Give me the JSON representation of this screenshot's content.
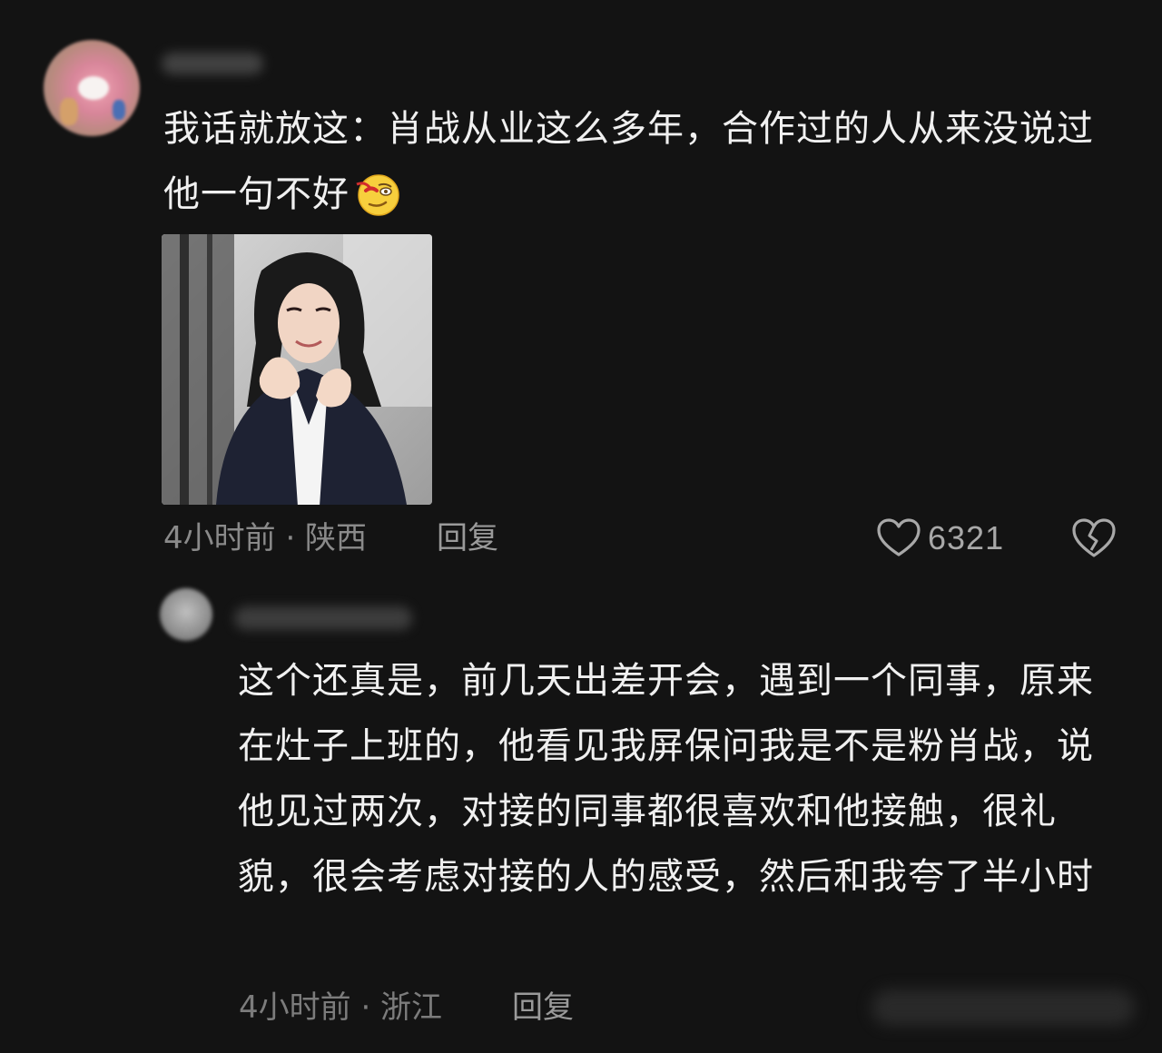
{
  "comment": {
    "text": "我话就放这：肖战从业这么多年，合作过的人从来没说过他一句不好",
    "emoji_icon": "smirk-emoji-icon",
    "meta": "4小时前 · 陕西",
    "reply_label": "回复",
    "like_count": "6321",
    "like_icon": "heart-outline-icon",
    "dislike_icon": "broken-heart-icon"
  },
  "reply": {
    "text": "这个还真是，前几天出差开会，遇到一个同事，原来在灶子上班的，他看见我屏保问我是不是粉肖战，说他见过两次，对接的同事都很喜欢和他接触，很礼貌，很会考虑对接的人的感受，然后和我夸了半小时",
    "meta": "4小时前 · 浙江",
    "reply_label": "回复"
  },
  "colors": {
    "background": "#131313",
    "text_primary": "#f0f0f0",
    "text_secondary": "#8a8a8a"
  }
}
